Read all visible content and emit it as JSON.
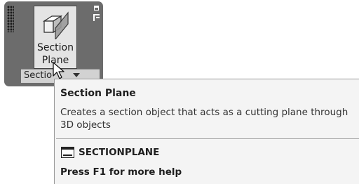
{
  "ribbon": {
    "panel_title": "Sectio",
    "tool": {
      "label_line1": "Section",
      "label_line2": "Plane",
      "icon": "section-plane-icon"
    }
  },
  "tooltip": {
    "title": "Section Plane",
    "description": "Creates a section object that acts as a cutting plane through 3D objects",
    "command_icon": "command-line-icon",
    "command": "SECTIONPLANE",
    "help": "Press F1 for more help"
  }
}
